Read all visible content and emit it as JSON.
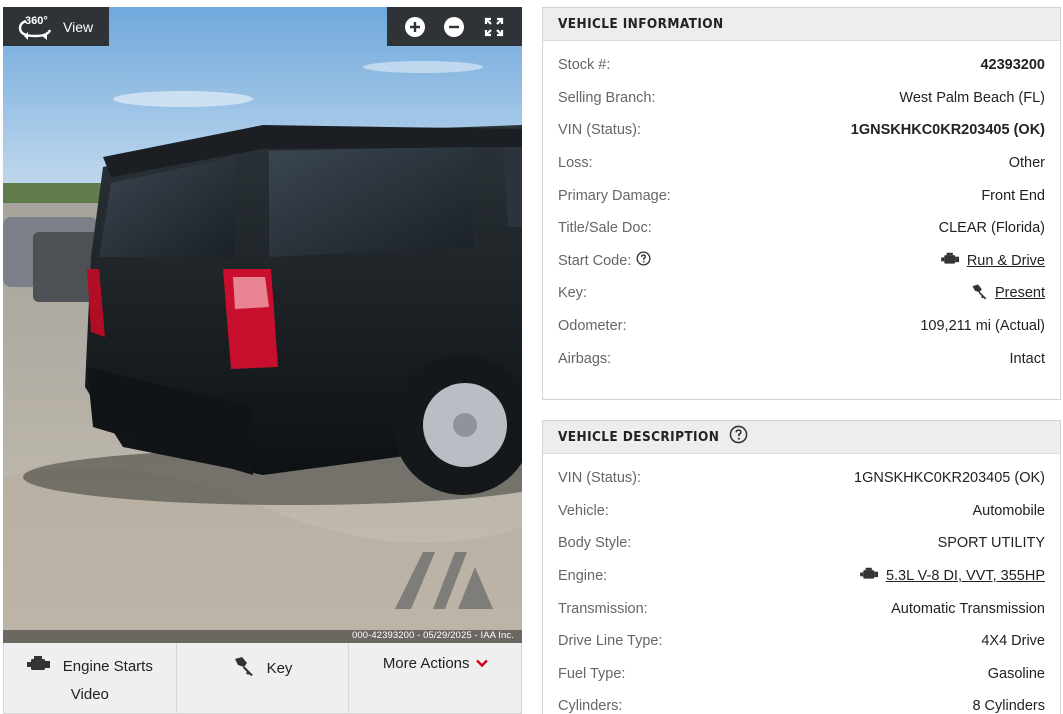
{
  "viewer": {
    "view360_badge": "360°",
    "view360_label": "View",
    "watermark": "IAA",
    "photo_stamp": "000-42393200 - 05/29/2025 - IAA Inc."
  },
  "actions": {
    "engine_label": "Engine Starts",
    "engine_sub": "Video",
    "key_label": "Key",
    "more_label": "More Actions"
  },
  "vehicle_information": {
    "title": "VEHICLE INFORMATION",
    "rows": [
      {
        "label": "Stock #:",
        "value": "42393200"
      },
      {
        "label": "Selling Branch:",
        "value": "West Palm Beach (FL)"
      },
      {
        "label": "VIN (Status):",
        "value": "1GNSKHKC0KR203405 (OK)"
      },
      {
        "label": "Loss:",
        "value": "Other"
      },
      {
        "label": "Primary Damage:",
        "value": "Front End"
      },
      {
        "label": "Title/Sale Doc:",
        "value": "CLEAR (Florida)"
      },
      {
        "label": "Start Code:",
        "value": "Run & Drive"
      },
      {
        "label": "Key:",
        "value": "Present"
      },
      {
        "label": "Odometer:",
        "value": "109,211 mi (Actual)"
      },
      {
        "label": "Airbags:",
        "value": "Intact"
      }
    ]
  },
  "vehicle_description": {
    "title": "VEHICLE DESCRIPTION",
    "rows": [
      {
        "label": "VIN (Status):",
        "value": "1GNSKHKC0KR203405 (OK)"
      },
      {
        "label": "Vehicle:",
        "value": "Automobile"
      },
      {
        "label": "Body Style:",
        "value": "SPORT UTILITY"
      },
      {
        "label": "Engine:",
        "value": "5.3L V-8 DI, VVT, 355HP"
      },
      {
        "label": "Transmission:",
        "value": "Automatic Transmission"
      },
      {
        "label": "Drive Line Type:",
        "value": "4X4 Drive"
      },
      {
        "label": "Fuel Type:",
        "value": "Gasoline"
      },
      {
        "label": "Cylinders:",
        "value": "8 Cylinders"
      }
    ]
  },
  "colors": {
    "accent_red": "#d0021b",
    "header_bg": "#ededed",
    "control_bg": "#2f3338"
  }
}
